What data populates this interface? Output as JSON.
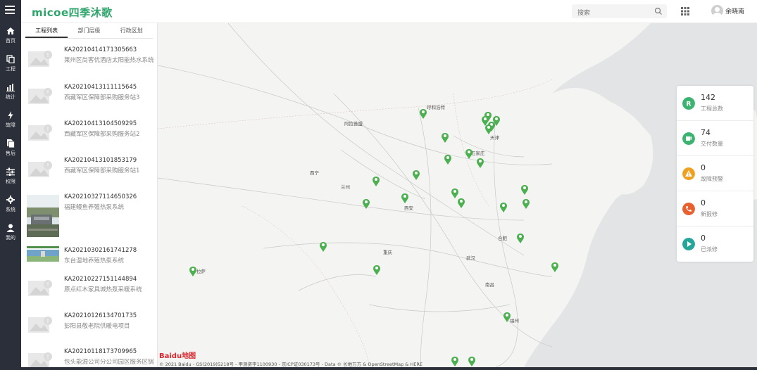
{
  "header": {
    "logo": "micoe四季沐歌",
    "search_placeholder": "搜索",
    "username": "余晓南"
  },
  "sidebar": {
    "items": [
      {
        "label": "首页",
        "icon": "home-icon"
      },
      {
        "label": "工程",
        "icon": "project-icon"
      },
      {
        "label": "统计",
        "icon": "chart-icon"
      },
      {
        "label": "故障",
        "icon": "bolt-icon"
      },
      {
        "label": "售后",
        "icon": "document-icon"
      },
      {
        "label": "权限",
        "icon": "sliders-icon"
      },
      {
        "label": "系统",
        "icon": "gear-icon"
      },
      {
        "label": "我的",
        "icon": "user-icon"
      }
    ]
  },
  "panel": {
    "tabs": [
      "工程列表",
      "部门层级",
      "行政区划"
    ],
    "items": [
      {
        "id": "KA20210414171305663",
        "name": "莱州区尚客优酒店太阳能热水系统",
        "thumb": "placeholder"
      },
      {
        "id": "KA20210413111115645",
        "name": "西藏军区保障部采购服务站3",
        "thumb": "placeholder"
      },
      {
        "id": "KA20210413104509295",
        "name": "西藏军区保障部采购服务站2",
        "thumb": "placeholder"
      },
      {
        "id": "KA20210413101853179",
        "name": "西藏军区保障部采购服务站1",
        "thumb": "placeholder"
      },
      {
        "id": "KA20210327114650326",
        "name": "福建鳗鱼养殖热泵系统",
        "thumb": "photo"
      },
      {
        "id": "KA20210302161741278",
        "name": "东台湿地养殖热泵系统",
        "thumb": "banner"
      },
      {
        "id": "KA20210227151144894",
        "name": "原点红木家具城热泵采暖系统",
        "thumb": "placeholder"
      },
      {
        "id": "KA20210126134701735",
        "name": "彭阳县敬老院供暖电项目",
        "thumb": "placeholder"
      },
      {
        "id": "KA20210118173709965",
        "name": "包头能源公司分公司园区服务区锅",
        "thumb": "placeholder"
      }
    ]
  },
  "stats": [
    {
      "value": "142",
      "label": "工程总数",
      "color": "#3cb371",
      "icon": "r-icon"
    },
    {
      "value": "74",
      "label": "交付数量",
      "color": "#3cb371",
      "icon": "cup-icon"
    },
    {
      "value": "0",
      "label": "故障预警",
      "color": "#f0a020",
      "icon": "warning-icon"
    },
    {
      "value": "0",
      "label": "新报修",
      "color": "#e86030",
      "icon": "phone-icon"
    },
    {
      "value": "0",
      "label": "已派修",
      "color": "#26a69a",
      "icon": "play-icon"
    }
  ],
  "map": {
    "attribution": "© 2021 Baidu - GS(2019)5218号 - 甲测资字1100930 - 京ICP证030173号 - Data © 长地万方 & OpenStreetMap & HERE",
    "baidu_logo": "Baidu地图",
    "marker_color": "#4caf50",
    "labels": [
      "呼和浩特",
      "阿拉善盟",
      "西宁",
      "兰州",
      "西安",
      "石家庄",
      "天津",
      "合肥",
      "武汉",
      "福州",
      "南昌",
      "拉萨",
      "重庆"
    ]
  }
}
